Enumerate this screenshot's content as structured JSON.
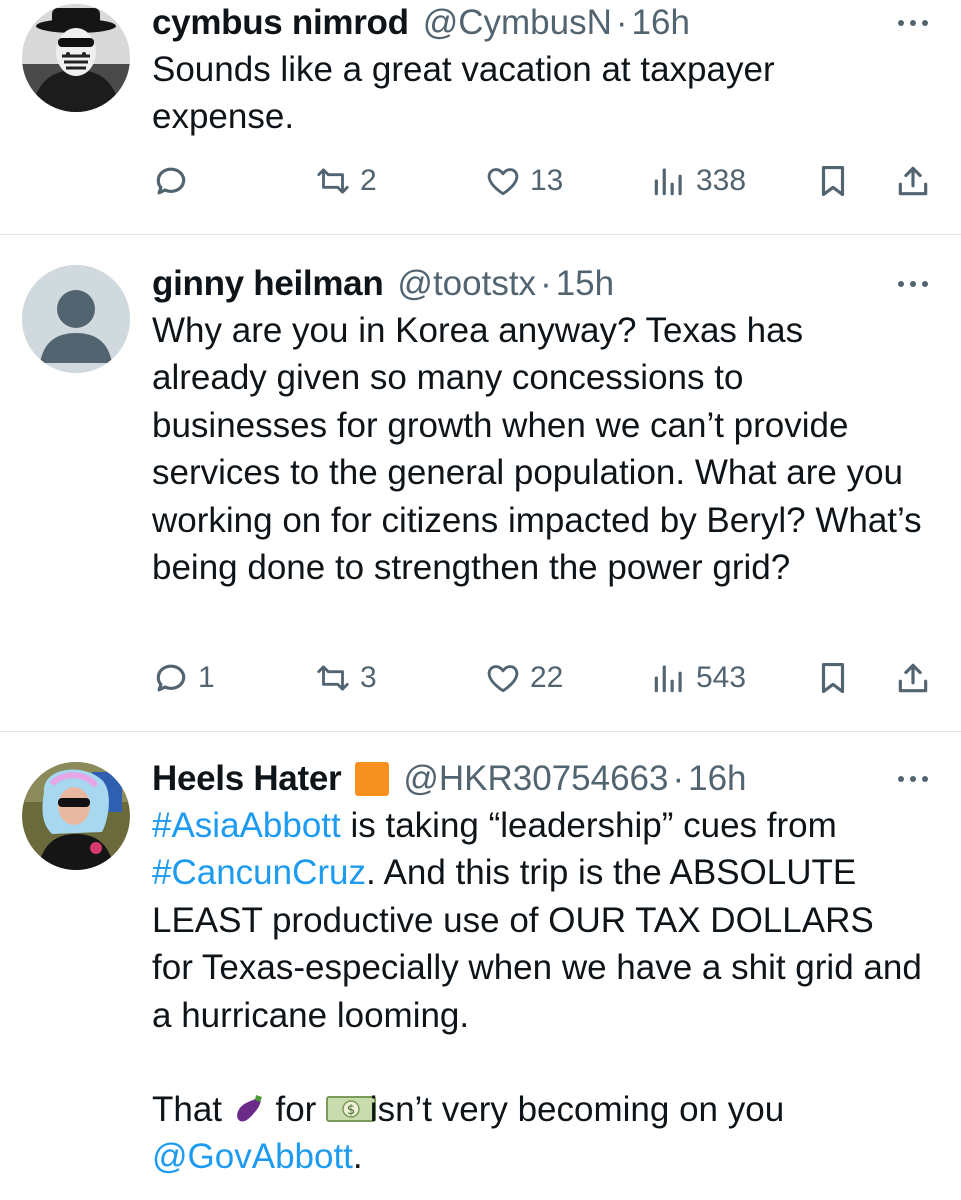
{
  "tweets": [
    {
      "name": "cymbus nimrod",
      "handle": "@CymbusN",
      "time": "16h",
      "text": "Sounds like a great vacation at taxpayer expense.",
      "replies": "",
      "retweets": "2",
      "likes": "13",
      "views": "338"
    },
    {
      "name": "ginny heilman",
      "handle": "@tootstx",
      "time": "15h",
      "text": "Why are you in Korea anyway? Texas has already given so many concessions to businesses for growth when we can’t provide services to the general population. What are you working on for citizens impacted by Beryl? What’s being done to strengthen the power grid?",
      "replies": "1",
      "retweets": "3",
      "likes": "22",
      "views": "543"
    },
    {
      "name": "Heels Hater",
      "handle": "@HKR30754663",
      "time": "16h",
      "hashtag1": "#AsiaAbbott",
      "text1": " is taking “leadership” cues from ",
      "hashtag2": "#CancunCruz",
      "text2": ". And this trip is the ABSOLUTE LEAST productive use of OUR TAX DOLLARS for Texas-especially when we have a shit grid and a hurricane looming.",
      "p2_a": "That ",
      "p2_b": " for ",
      "p2_c": " isn’t very becoming on you ",
      "mention": "@GovAbbott",
      "p2_end": "."
    }
  ],
  "icons": {
    "more": "more-icon",
    "reply": "reply-icon",
    "retweet": "retweet-icon",
    "like": "like-icon",
    "views": "views-icon",
    "bookmark": "bookmark-icon",
    "share": "share-icon",
    "square_emoji": "orange-square",
    "eggplant_emoji": "eggplant",
    "money_emoji": "dollar-banknote"
  },
  "colors": {
    "link": "#1d9bf0",
    "secondary": "#536471",
    "divider": "#e1e5e9",
    "text": "#0f1419"
  }
}
